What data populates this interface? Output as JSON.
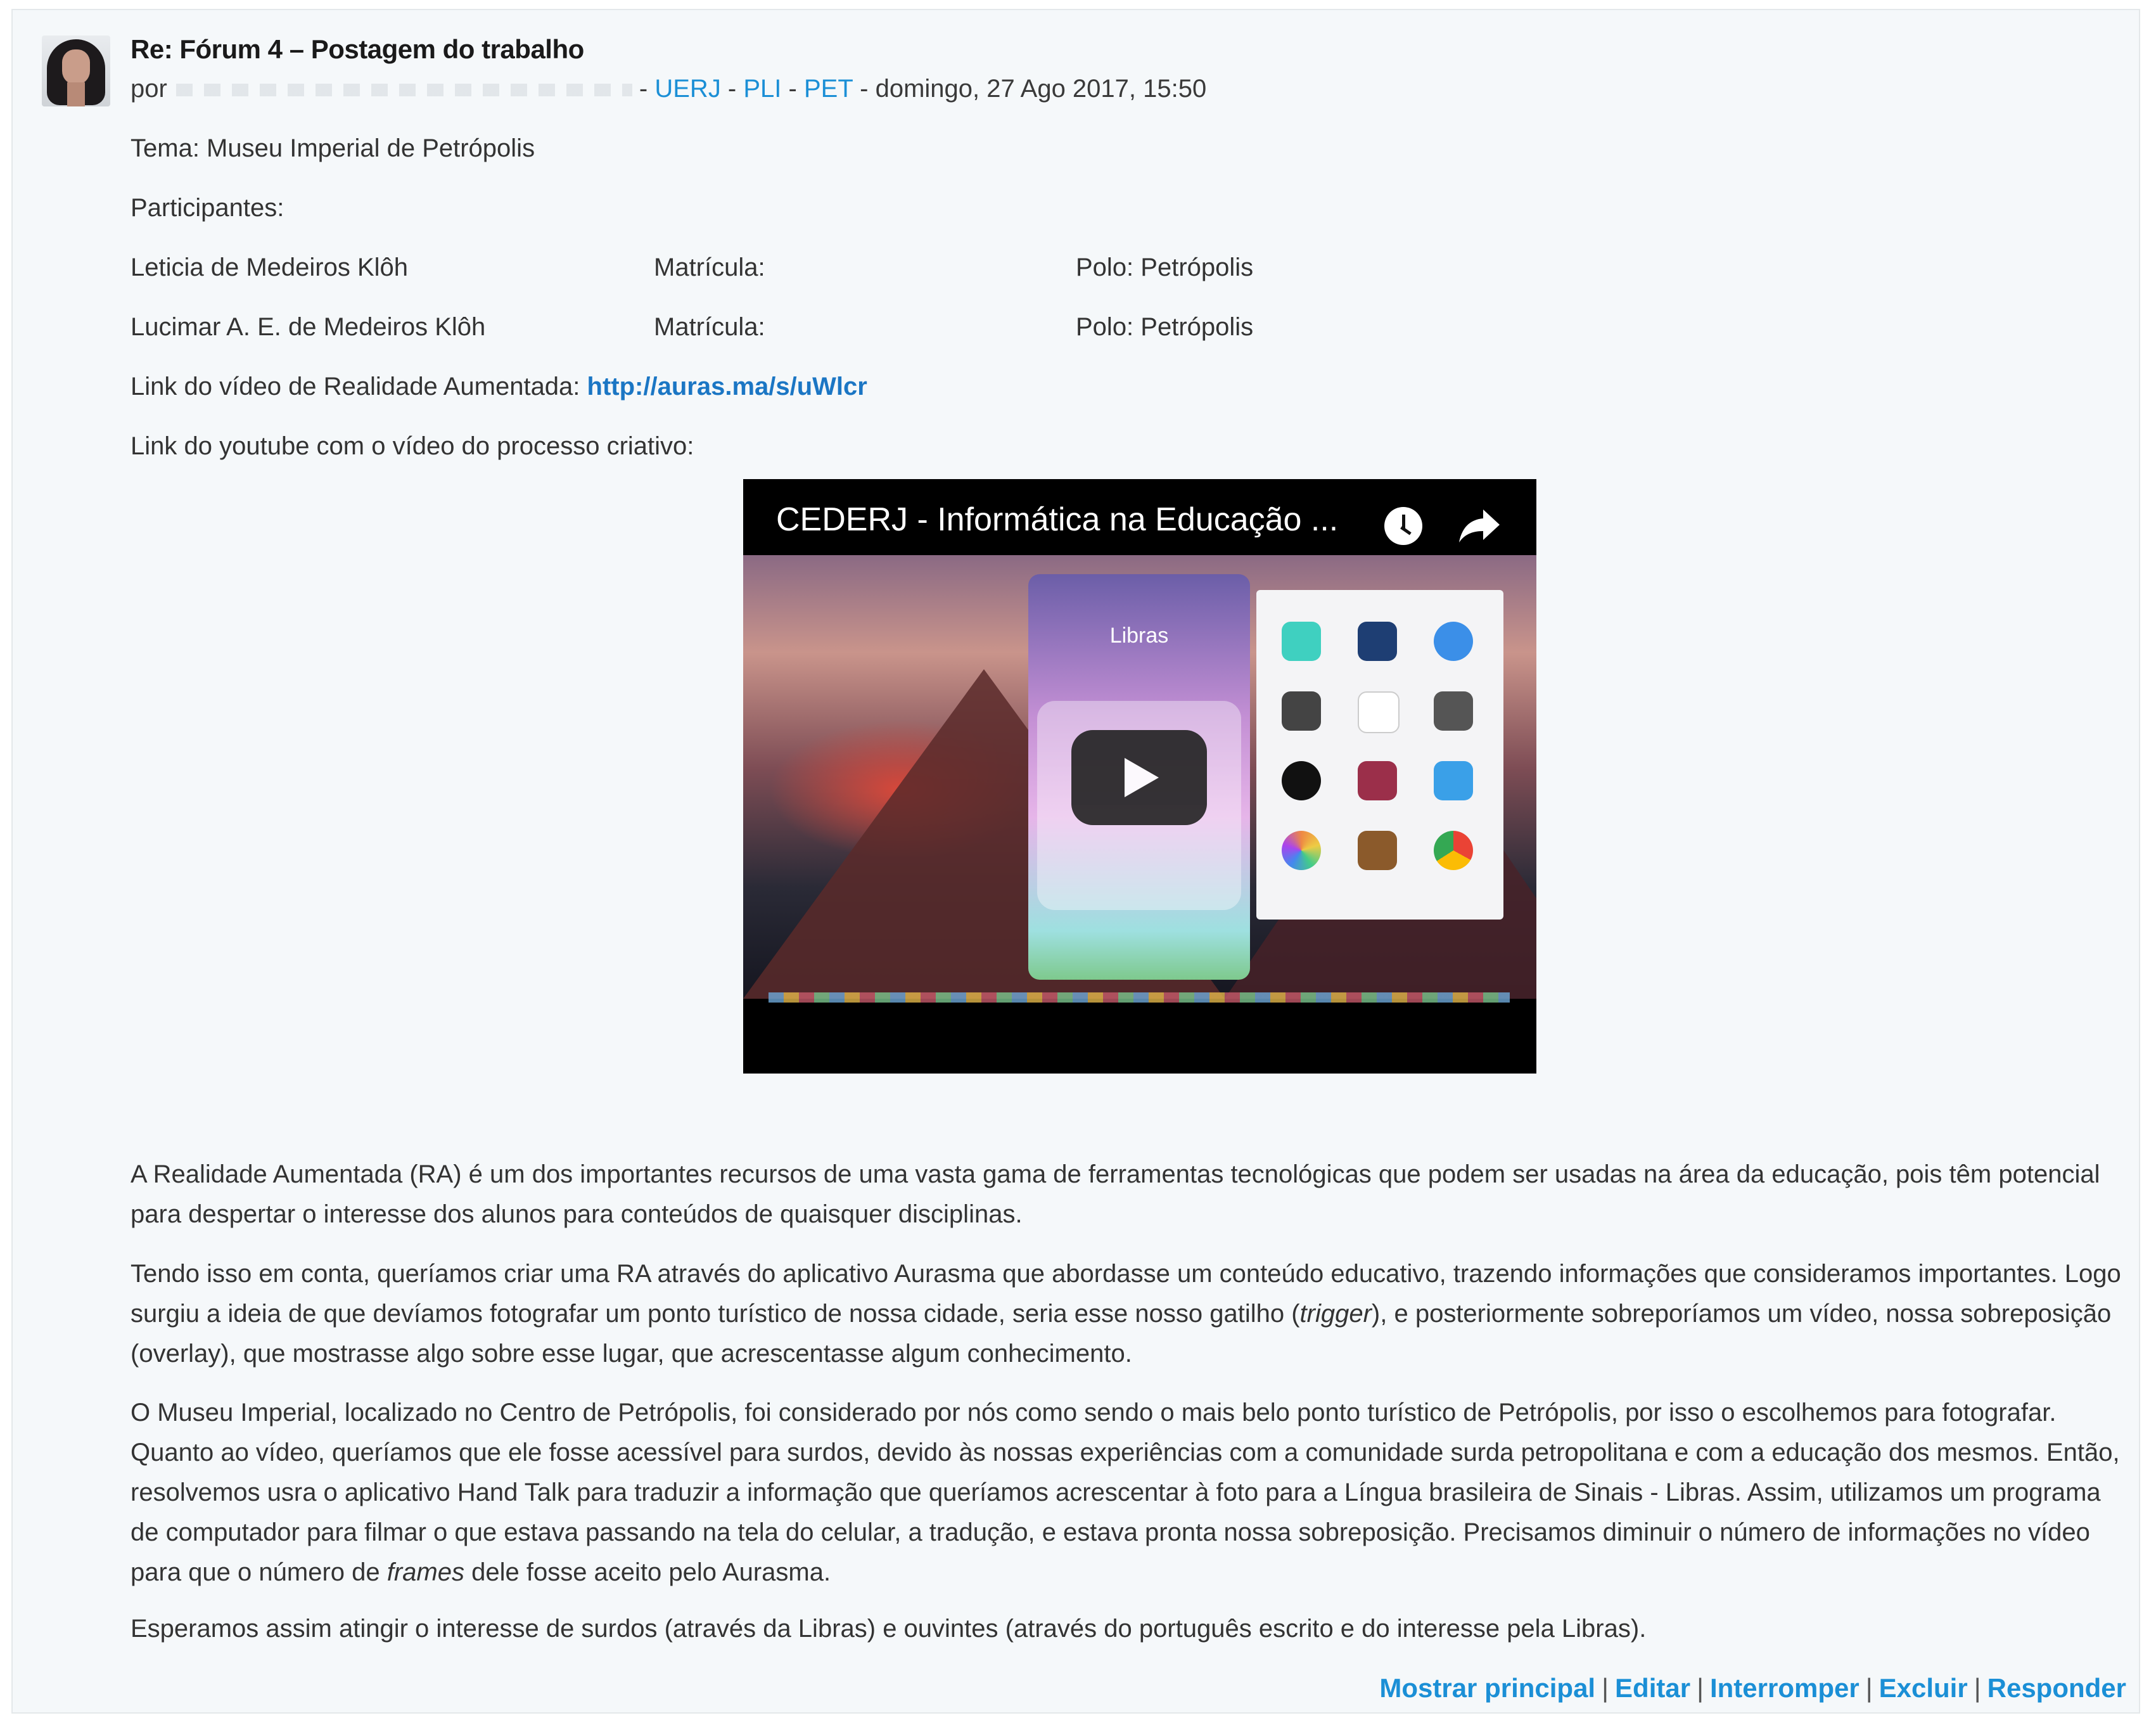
{
  "post": {
    "title": "Re: Fórum 4 – Postagem do trabalho",
    "by_prefix": "por",
    "groups": [
      "UERJ",
      "PLI",
      "PET"
    ],
    "date": "domingo, 27 Ago 2017, 15:50",
    "theme": "Tema: Museu Imperial de Petrópolis",
    "participants_label": "Participantes:",
    "participants": [
      {
        "name": "Leticia de Medeiros Klôh",
        "registration": "Matrícula:",
        "polo": "Polo: Petrópolis"
      },
      {
        "name": "Lucimar A. E. de Medeiros Klôh",
        "registration": "Matrícula:",
        "polo": "Polo: Petrópolis"
      }
    ],
    "ar_link_label": "Link do vídeo de Realidade Aumentada:",
    "ar_link_url": "http://auras.ma/s/uWlcr",
    "youtube_label": "Link do youtube com o vídeo do processo criativo:",
    "video": {
      "title": "CEDERJ - Informática na Educação ...",
      "inner_label": "Libras",
      "icons": [
        "clock-icon",
        "share-icon",
        "play-icon"
      ]
    },
    "paragraphs": {
      "p1": "A Realidade Aumentada (RA) é um dos importantes recursos de uma vasta gama de ferramentas tecnológicas que podem ser usadas na área da educação, pois têm potencial para despertar o interesse dos alunos para conteúdos de quaisquer disciplinas.",
      "p2_a": "Tendo isso em conta, queríamos criar uma RA através do aplicativo Aurasma que abordasse um conteúdo educativo, trazendo informações que consideramos importantes. Logo surgiu a ideia de que devíamos fotografar um ponto turístico de nossa cidade, seria esse nosso gatilho (",
      "p2_em": "trigger",
      "p2_b": "), e posteriormente sobreporíamos um vídeo, nossa sobreposição (overlay), que mostrasse algo sobre esse lugar, que acrescentasse algum conhecimento.",
      "p3_a": "O Museu Imperial, localizado no Centro de Petrópolis, foi considerado por nós como sendo o mais belo ponto turístico de Petrópolis, por isso o escolhemos para fotografar.  Quanto ao vídeo, queríamos que ele fosse acessível para surdos, devido às nossas experiências com a comunidade surda petropolitana e com a educação dos mesmos. Então, resolvemos usra o aplicativo Hand Talk para traduzir a informação que queríamos acrescentar à foto para a Língua brasileira de Sinais - Libras. Assim, utilizamos um programa de computador para filmar o que estava passando na tela do celular, a tradução, e estava pronta nossa sobreposição. Precisamos diminuir o número de informações no vídeo para que o número de ",
      "p3_em": "frames",
      "p3_b": " dele fosse aceito pelo Aurasma.",
      "p4": "Esperamos assim atingir o interesse de surdos (através da Libras) e ouvintes (através do português escrito e do interesse pela Libras)."
    },
    "actions": [
      "Mostrar principal",
      "Editar",
      "Interromper",
      "Excluir",
      "Responder"
    ]
  },
  "colors": {
    "link": "#1b8fd6",
    "post_bg": "#f5f8fa",
    "border": "#e4e8ea"
  }
}
